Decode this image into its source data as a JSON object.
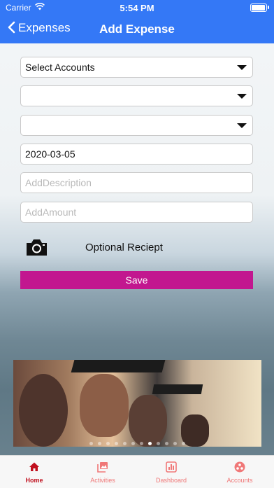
{
  "status_bar": {
    "carrier": "Carrier",
    "time": "5:54 PM"
  },
  "nav": {
    "back_label": "Expenses",
    "title": "Add Expense"
  },
  "form": {
    "accounts_select": "Select Accounts",
    "select_2": "",
    "select_3": "",
    "date_value": "2020-03-05",
    "description_placeholder": "AddDescription",
    "amount_placeholder": "AddAmount",
    "receipt_label": "Optional Reciept",
    "save_label": "Save"
  },
  "banner": {
    "slide_count": 12,
    "active_slide": 7
  },
  "tabs": [
    {
      "label": "Home",
      "icon": "home-icon",
      "active": true
    },
    {
      "label": "Activities",
      "icon": "image-gallery-icon",
      "active": false
    },
    {
      "label": "Dashboard",
      "icon": "chart-icon",
      "active": false
    },
    {
      "label": "Accounts",
      "icon": "accounts-icon",
      "active": false
    }
  ],
  "colors": {
    "nav": "#3478f6",
    "save": "#c2178f",
    "tab_active": "#c0101e",
    "tab_inactive": "#f07878"
  }
}
